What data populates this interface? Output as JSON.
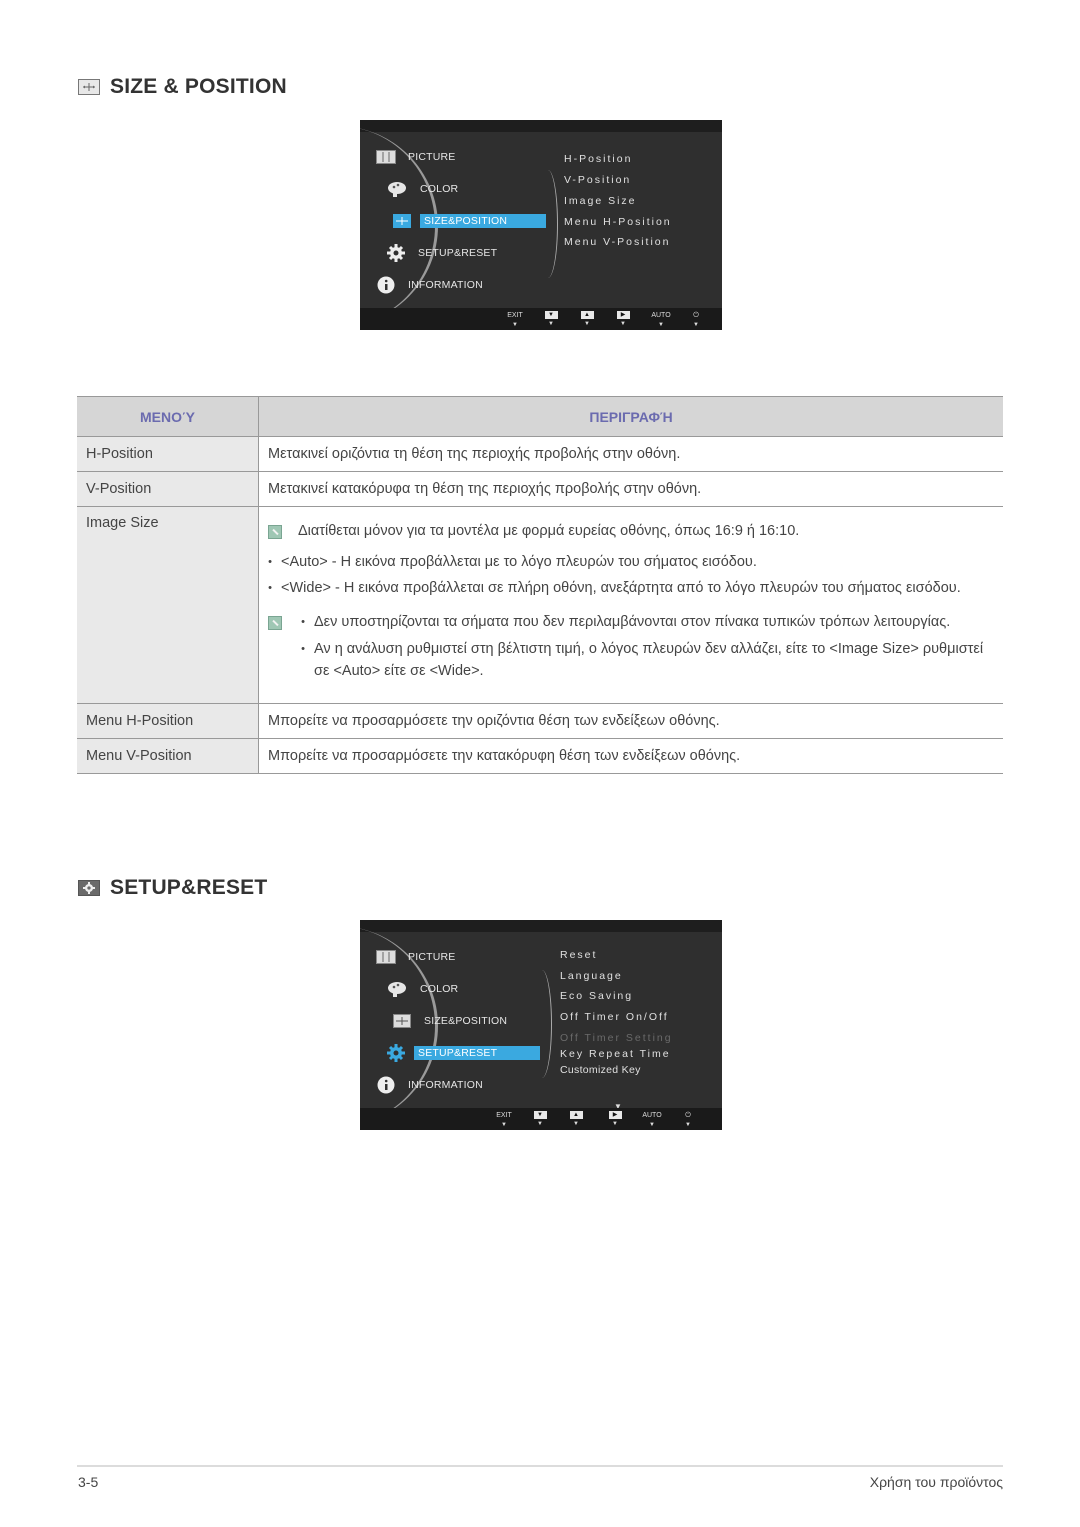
{
  "sections": [
    {
      "title": "SIZE & POSITION",
      "icon": "size-position-icon",
      "osd": {
        "menu": [
          {
            "label": "PICTURE",
            "icon": "picture-icon",
            "active": false
          },
          {
            "label": "COLOR",
            "icon": "palette-icon",
            "active": false
          },
          {
            "label": "SIZE&POSITION",
            "icon": "size-position-icon",
            "active": true
          },
          {
            "label": "SETUP&RESET",
            "icon": "gear-icon",
            "active": false
          },
          {
            "label": "INFORMATION",
            "icon": "info-icon",
            "active": false
          }
        ],
        "submenu": [
          "H-Position",
          "V-Position",
          "Image Size",
          "Menu H-Position",
          "Menu V-Position"
        ],
        "buttons": [
          "EXIT",
          "▼",
          "▲",
          "▶",
          "AUTO",
          "⏻"
        ]
      }
    },
    {
      "title": "SETUP&RESET",
      "icon": "gear-icon",
      "osd": {
        "menu": [
          {
            "label": "PICTURE",
            "icon": "picture-icon",
            "active": false
          },
          {
            "label": "COLOR",
            "icon": "palette-icon",
            "active": false
          },
          {
            "label": "SIZE&POSITION",
            "icon": "size-position-icon",
            "active": false
          },
          {
            "label": "SETUP&RESET",
            "icon": "gear-icon",
            "active": true
          },
          {
            "label": "INFORMATION",
            "icon": "info-icon",
            "active": false
          }
        ],
        "submenu": [
          "Reset",
          "Language",
          "Eco Saving",
          "Off Timer On/Off",
          "Off Timer Setting",
          "Key Repeat Time",
          "Customized Key"
        ],
        "submenu_disabled": [
          "Off Timer Setting"
        ],
        "more_indicator": "▼",
        "buttons": [
          "EXIT",
          "▼",
          "▲",
          "▶",
          "AUTO",
          "⏻"
        ]
      }
    }
  ],
  "table": {
    "headers": {
      "menu": "ΜΕΝΟΎ",
      "description": "ΠΕΡΙΓΡΑΦΉ"
    },
    "rows": [
      {
        "menu": "H-Position",
        "description": "Μετακινεί οριζόντια τη θέση της περιοχής προβολής στην οθόνη."
      },
      {
        "menu": "V-Position",
        "description": "Μετακινεί κατακόρυφα τη θέση της περιοχής προβολής στην οθόνη."
      },
      {
        "menu": "Image Size",
        "note": "Διατίθεται μόνον για τα μοντέλα με φορμά ευρείας οθόνης, όπως 16:9 ή 16:10.",
        "bullets": [
          "<Auto> - Η εικόνα προβάλλεται με το λόγο πλευρών του σήματος εισόδου.",
          "<Wide> - Η εικόνα προβάλλεται σε πλήρη οθόνη, ανεξάρτητα από το λόγο πλευρών του σήματος εισόδου."
        ],
        "note_bullets": [
          "Δεν υποστηρίζονται τα σήματα που δεν περιλαμβάνονται στον πίνακα τυπικών τρόπων λειτουργίας.",
          "Αν η ανάλυση ρυθμιστεί στη βέλτιστη τιμή, ο λόγος πλευρών δεν αλλάζει, είτε το <Image Size> ρυθμιστεί σε <Auto> είτε σε <Wide>."
        ]
      },
      {
        "menu": "Menu H-Position",
        "description": "Μπορείτε να προσαρμόσετε την οριζόντια θέση των ενδείξεων οθόνης."
      },
      {
        "menu": "Menu V-Position",
        "description": "Μπορείτε να προσαρμόσετε την κατακόρυφη θέση των ενδείξεων οθόνης."
      }
    ]
  },
  "footer": {
    "page_number": "3-5",
    "chapter": "Χρήση του προϊόντος"
  },
  "colors": {
    "osd_highlight": "#3aa9e0",
    "table_header_text": "#6b6baf",
    "table_header_bg": "#d6d6d6"
  }
}
